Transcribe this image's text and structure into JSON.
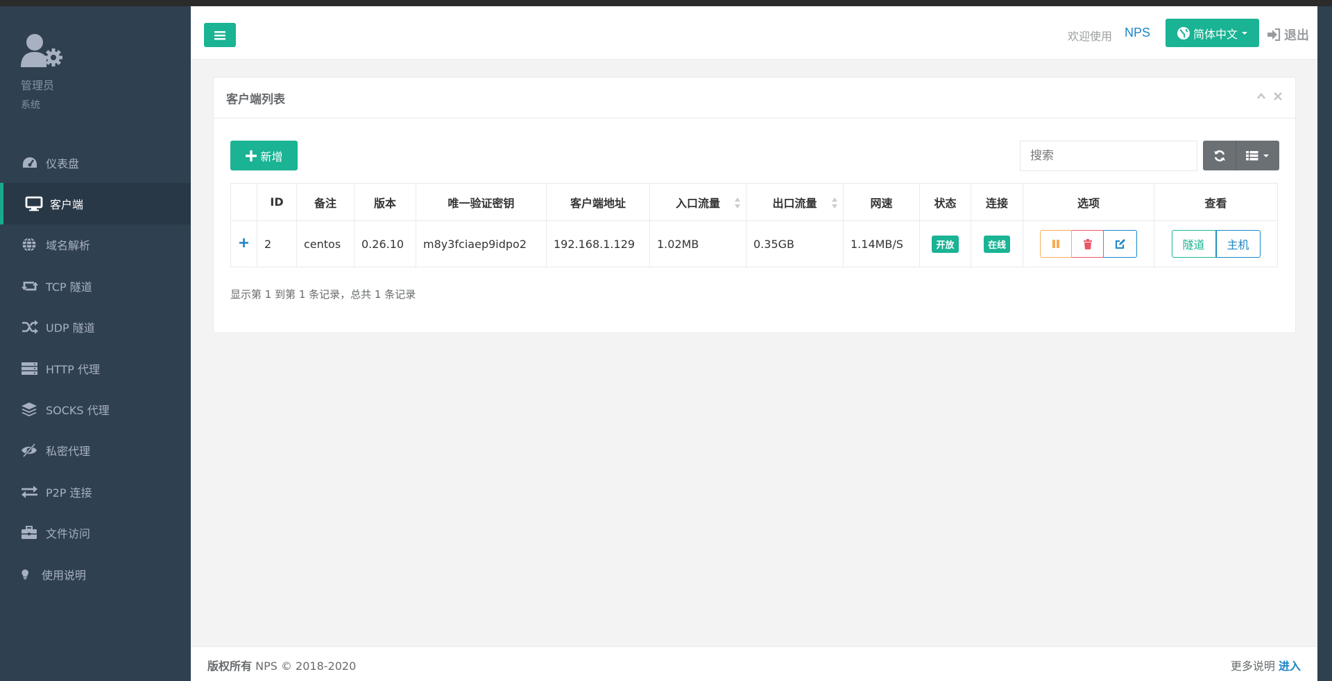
{
  "user": {
    "name": "管理员",
    "role": "系统"
  },
  "nav": [
    {
      "label": "仪表盘",
      "icon": "dashboard-icon"
    },
    {
      "label": "客户端",
      "icon": "monitor-icon",
      "active": true
    },
    {
      "label": "域名解析",
      "icon": "globe-icon"
    },
    {
      "label": "TCP 隧道",
      "icon": "retweet-icon"
    },
    {
      "label": "UDP 隧道",
      "icon": "random-icon"
    },
    {
      "label": "HTTP 代理",
      "icon": "server-icon"
    },
    {
      "label": "SOCKS 代理",
      "icon": "layers-icon"
    },
    {
      "label": "私密代理",
      "icon": "eye-slash-icon"
    },
    {
      "label": "P2P 连接",
      "icon": "exchange-icon"
    },
    {
      "label": "文件访问",
      "icon": "briefcase-icon"
    },
    {
      "label": "使用说明",
      "icon": "lightbulb-icon"
    }
  ],
  "topbar": {
    "welcome": "欢迎使用",
    "brand": "NPS",
    "language": "简体中文",
    "logout": "退出"
  },
  "panel": {
    "title": "客户端列表",
    "add_label": "新增",
    "search_placeholder": "搜索",
    "columns": [
      "ID",
      "备注",
      "版本",
      "唯一验证密钥",
      "客户端地址",
      "入口流量",
      "出口流量",
      "网速",
      "状态",
      "连接",
      "选项",
      "查看"
    ],
    "rows": [
      {
        "id": "2",
        "remark": "centos",
        "version": "0.26.10",
        "vkey": "m8y3fciaep9idpo2",
        "addr": "192.168.1.129",
        "inflow": "1.02MB",
        "outflow": "0.35GB",
        "speed": "1.14MB/S",
        "status": "开放",
        "conn": "在线",
        "view_tunnel": "隧道",
        "view_host": "主机"
      }
    ],
    "pagination_info": "显示第 1 到第 1 条记录，总共 1 条记录"
  },
  "footer": {
    "copyright_bold": "版权所有",
    "copyright": "NPS © 2018-2020",
    "more": "更多说明",
    "enter": "进入"
  },
  "colors": {
    "primary": "#1ab394",
    "sidebar": "#2f4050",
    "link": "#1c84c6",
    "warning": "#f8ac59",
    "danger": "#ed5565"
  }
}
